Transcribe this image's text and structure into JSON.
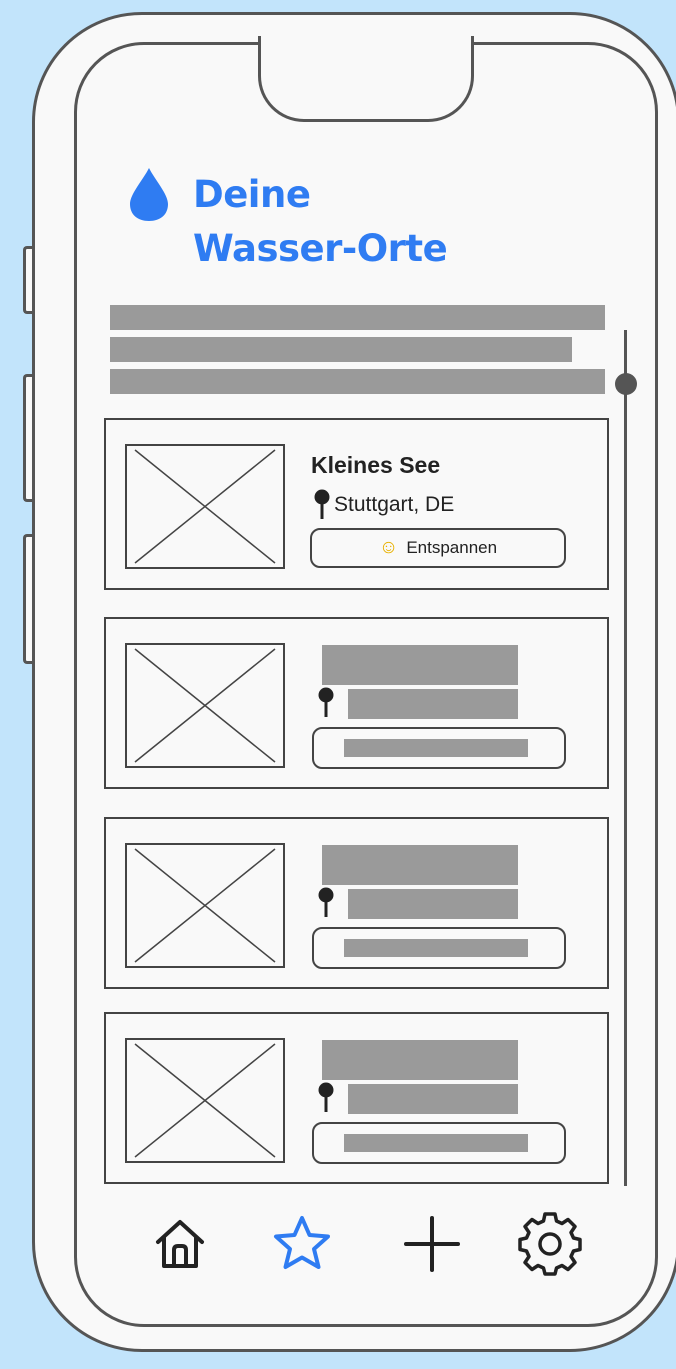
{
  "header": {
    "title_line1": "Deine",
    "title_line2": "Wasser-Orte",
    "icon": "water-drop-icon"
  },
  "places": [
    {
      "name": "Kleines See",
      "location": "Stuttgart, DE",
      "tag_label": "Entspannen",
      "tag_icon": "relaxing-person-emoji"
    }
  ],
  "navigation": {
    "items": [
      "home-icon",
      "star-icon",
      "plus-icon",
      "gear-icon"
    ],
    "active": "star-icon"
  },
  "colors": {
    "accent": "#2f7cf2",
    "background": "#c2e4fb",
    "placeholder": "#9a9a9a",
    "outline": "#555555"
  }
}
